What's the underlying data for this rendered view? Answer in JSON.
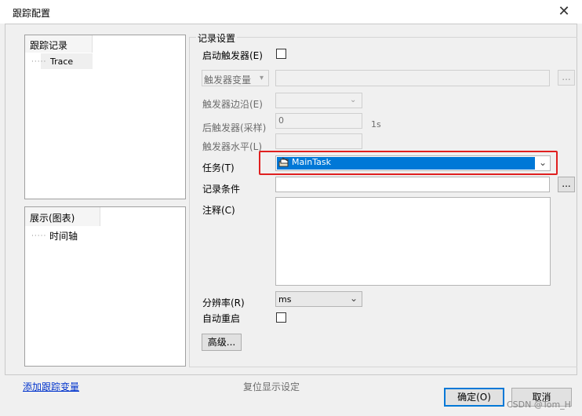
{
  "window": {
    "title": "跟踪配置"
  },
  "left": {
    "trace_panel": {
      "header": "跟踪记录",
      "item": "Trace"
    },
    "display_panel": {
      "header": "展示(图表)",
      "item": "时间轴"
    }
  },
  "record": {
    "section_title": "记录设置",
    "enable_trigger": {
      "label": "启动触发器(E)",
      "checked": false
    },
    "trigger_variable": {
      "label": "触发器变量",
      "value": "",
      "browse": "..."
    },
    "trigger_edge": {
      "label": "触发器边沿(E)",
      "value": ""
    },
    "post_trigger": {
      "label": "后触发器(采样)",
      "value": "0",
      "unit": "1s"
    },
    "trigger_level": {
      "label": "触发器水平(L)",
      "value": ""
    },
    "task": {
      "label": "任务(T)",
      "value": "MainTask"
    },
    "record_condition": {
      "label": "记录条件",
      "value": "",
      "browse": "..."
    },
    "comment": {
      "label": "注释(C)",
      "value": ""
    },
    "resolution": {
      "label": "分辨率(R)",
      "value": "ms"
    },
    "auto_restart": {
      "label": "自动重启",
      "checked": false
    },
    "advanced_button": "高级..."
  },
  "footer": {
    "add_variable_link": "添加跟踪变量",
    "reset_display": "复位显示设定",
    "ok": "确定(O)",
    "cancel": "取消"
  },
  "watermark": "CSDN @Tom_H",
  "colors": {
    "selection": "#0078d7",
    "highlight_box": "#e02020",
    "link": "#0033cc"
  }
}
